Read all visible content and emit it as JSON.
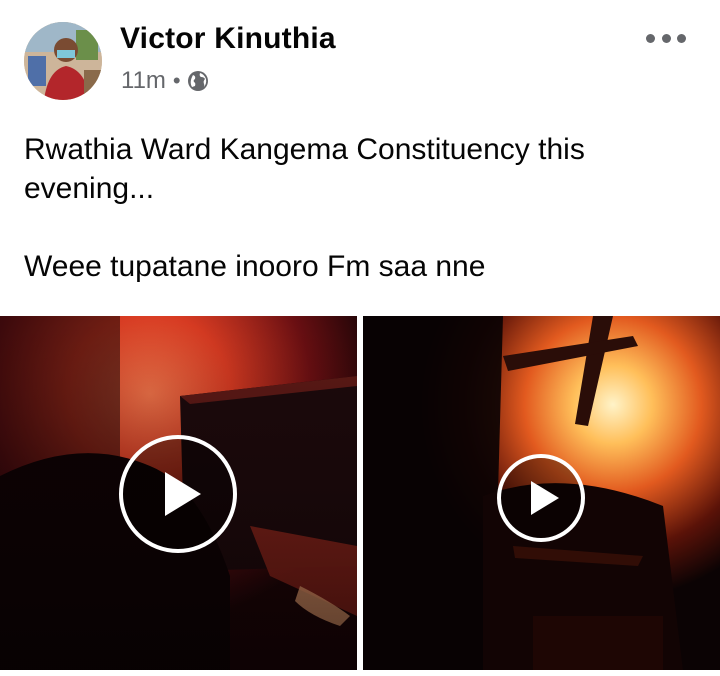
{
  "post": {
    "author_name": "Victor Kinuthia",
    "timestamp": "11m",
    "separator": "•",
    "privacy_icon": "globe-icon",
    "more_icon": "more-horizontal-icon",
    "text_line1": "Rwathia Ward Kangema Constituency this evening...",
    "text_line2": "Weee tupatane inooro Fm saa nne"
  },
  "media": {
    "videos": [
      {
        "name": "video-left",
        "play_icon": "play-icon"
      },
      {
        "name": "video-right",
        "play_icon": "play-icon"
      }
    ]
  },
  "colors": {
    "text_primary": "#050505",
    "text_secondary": "#65676b",
    "fire_orange": "#e8552a",
    "fire_yellow": "#ffd27a"
  }
}
